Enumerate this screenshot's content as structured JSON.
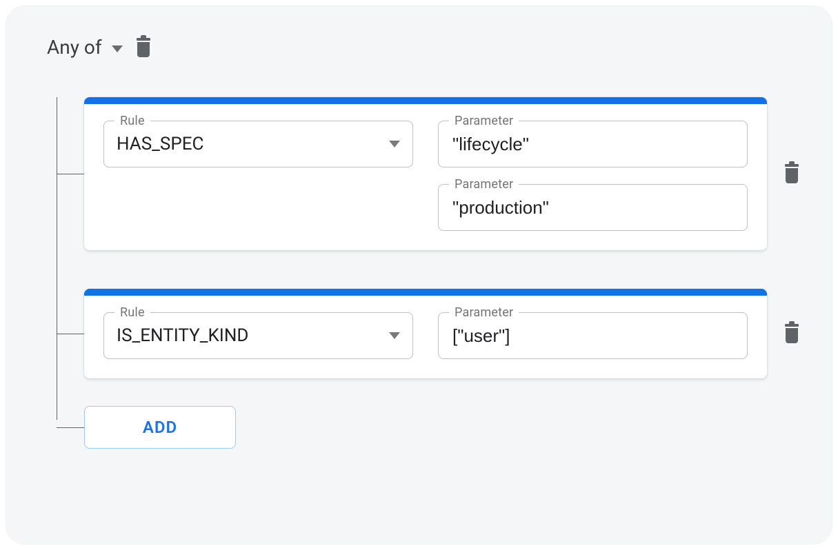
{
  "combinator": {
    "label": "Any of"
  },
  "labels": {
    "rule": "Rule",
    "parameter": "Parameter"
  },
  "rules": [
    {
      "rule": "HAS_SPEC",
      "params": [
        "\"lifecycle\"",
        "\"production\""
      ]
    },
    {
      "rule": "IS_ENTITY_KIND",
      "params": [
        "[\"user\"]"
      ]
    }
  ],
  "actions": {
    "add": "ADD"
  }
}
